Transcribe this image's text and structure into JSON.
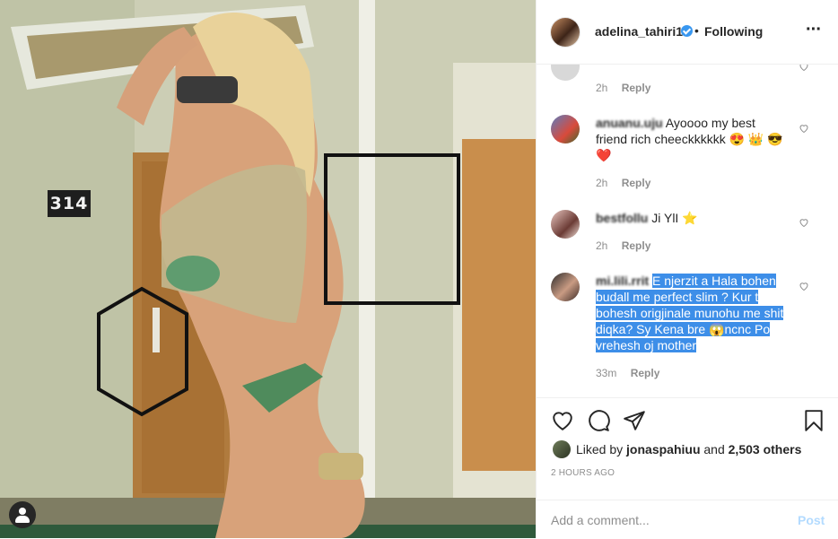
{
  "post": {
    "room_number": "314",
    "colors": {
      "accent": "#0095f6",
      "highlight": "#3d8ee8",
      "verified": "#3897f0"
    }
  },
  "header": {
    "username": "adelina_tahiri1",
    "separator": "•",
    "follow_status": "Following",
    "more_icon": "more-options-icon"
  },
  "comments": [
    {
      "username": "",
      "text": "",
      "time": "2h",
      "reply": "Reply",
      "note": "partially cropped top comment"
    },
    {
      "username": "anuanu.uju",
      "text": "Ayoooo my best friend rich cheeckkkkkk 😍 👑 😎❤️",
      "time": "2h",
      "reply": "Reply"
    },
    {
      "username": "bestfollu",
      "text": "Ji YlI ⭐",
      "time": "2h",
      "reply": "Reply"
    },
    {
      "username": "mi.lili.rrit",
      "text": "E njerzit a Hala bohen budall me perfect slim ? Kur t bohesh origjinale munohu me shit diqka? Sy Kena bre 😱ncnc Po vrehesh oj mother",
      "time": "33m",
      "reply": "Reply"
    }
  ],
  "actions": {
    "liked_by_prefix": "Liked by",
    "liked_by_user": "jonaspahiuu",
    "liked_by_and": "and",
    "liked_by_count": "2,503 others",
    "time_ago": "2 HOURS AGO"
  },
  "comment_box": {
    "placeholder": "Add a comment...",
    "post_label": "Post"
  }
}
